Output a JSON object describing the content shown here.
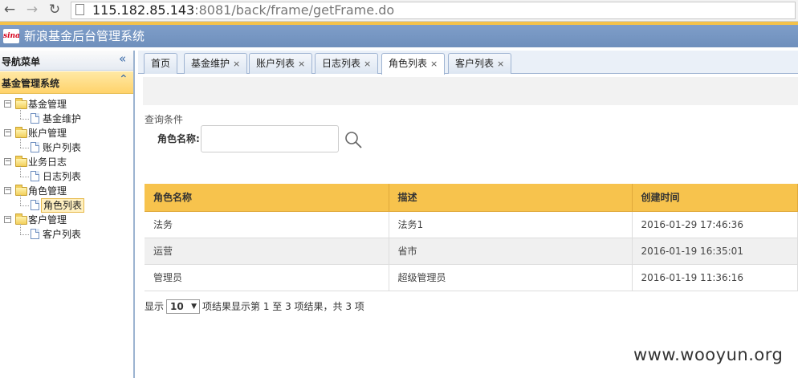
{
  "browser": {
    "url_host": "115.182.85.143",
    "url_rest": ":8081/back/frame/getFrame.do",
    "back_icon": "arrow-left-icon",
    "forward_icon": "arrow-right-icon",
    "reload_icon": "reload-icon"
  },
  "app": {
    "logo_text": "sina",
    "title": "新浪基金后台管理系统"
  },
  "sidebar": {
    "nav_title": "导航菜单",
    "section_title": "基金管理系统",
    "tree": [
      {
        "label": "基金管理",
        "children": [
          {
            "label": "基金维护"
          }
        ]
      },
      {
        "label": "账户管理",
        "children": [
          {
            "label": "账户列表"
          }
        ]
      },
      {
        "label": "业务日志",
        "children": [
          {
            "label": "日志列表"
          }
        ]
      },
      {
        "label": "角色管理",
        "children": [
          {
            "label": "角色列表",
            "selected": true
          }
        ]
      },
      {
        "label": "客户管理",
        "children": [
          {
            "label": "客户列表"
          }
        ]
      }
    ]
  },
  "tabs": [
    {
      "label": "首页",
      "closable": false
    },
    {
      "label": "基金维护",
      "closable": true
    },
    {
      "label": "账户列表",
      "closable": true
    },
    {
      "label": "日志列表",
      "closable": true
    },
    {
      "label": "角色列表",
      "closable": true,
      "active": true
    },
    {
      "label": "客户列表",
      "closable": true
    }
  ],
  "tab_close_glyph": "×",
  "query": {
    "title": "查询条件",
    "role_name_label": "角色名称:",
    "role_name_value": ""
  },
  "table": {
    "columns": [
      "角色名称",
      "描述",
      "创建时间"
    ],
    "rows": [
      [
        "法务",
        "法务1",
        "2016-01-29 17:46:36"
      ],
      [
        "运营",
        "省市",
        "2016-01-19 16:35:01"
      ],
      [
        "管理员",
        "超级管理员",
        "2016-01-19 11:36:16"
      ]
    ]
  },
  "paging": {
    "show_label": "显示",
    "page_size": "10",
    "suffix": "项结果显示第 1 至 3 项结果，共 3 项"
  },
  "watermark": "www.wooyun.org",
  "colors": {
    "header_blue": "#7f9ec9",
    "accent_gold": "#f7c34d",
    "section_yellow": "#ffd36b"
  }
}
